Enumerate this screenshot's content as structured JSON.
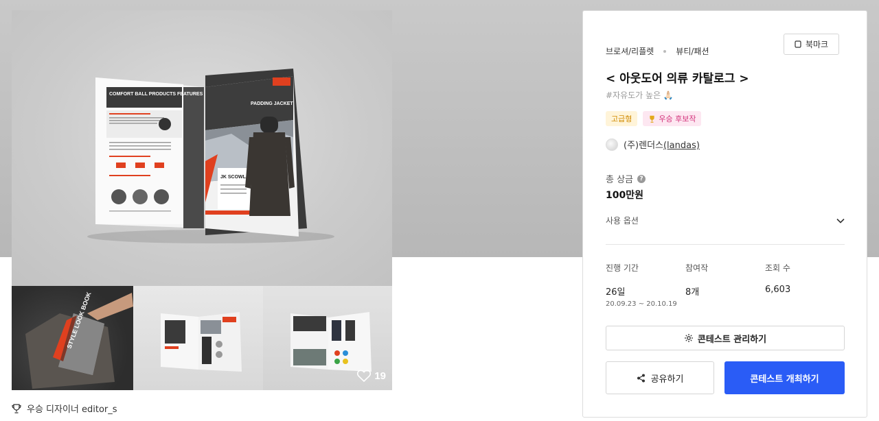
{
  "gallery": {
    "likes": "19",
    "designer_label": "우승 디자이너 editor_s",
    "main_image": {
      "left_page_heading": "COMFORT BALL PRODUCTS FEATURES",
      "right_page_heading": "PADDING JACKET",
      "product_name": "JK SCOWL"
    },
    "thumb1_text": "STYLE LOOK BOOK"
  },
  "panel": {
    "category_primary": "브로셔/리플렛",
    "category_secondary": "뷰티/패션",
    "bookmark_label": "북마크",
    "title": "< 아웃도어 의류 카탈로그 >",
    "subtitle": "#자유도가 높은 🙏🏻",
    "badge_premium": "고급형",
    "badge_award": "우승 후보작",
    "company_name": "(주)렌더스",
    "company_link": "(landas)",
    "prize_label": "총 상금",
    "prize_value": "100만원",
    "usage_label": "사용 옵션",
    "stats": [
      {
        "label": "진행 기간",
        "value": "26일",
        "sub": "20.09.23 ~ 20.10.19"
      },
      {
        "label": "참여작",
        "value": "8개",
        "sub": ""
      },
      {
        "label": "조회 수",
        "value": "6,603",
        "sub": ""
      }
    ],
    "manage_label": "콘테스트 관리하기",
    "share_label": "공유하기",
    "host_label": "콘테스트 개최하기"
  },
  "colors": {
    "accent": "#2a5cf6",
    "catalog_red": "#e0401f",
    "premium": "#d08a00",
    "award": "#d2317a"
  },
  "icons": [
    "heart-icon",
    "trophy-icon",
    "bookmark-icon",
    "help-icon",
    "chevron-down-icon",
    "gear-icon",
    "share-icon"
  ]
}
